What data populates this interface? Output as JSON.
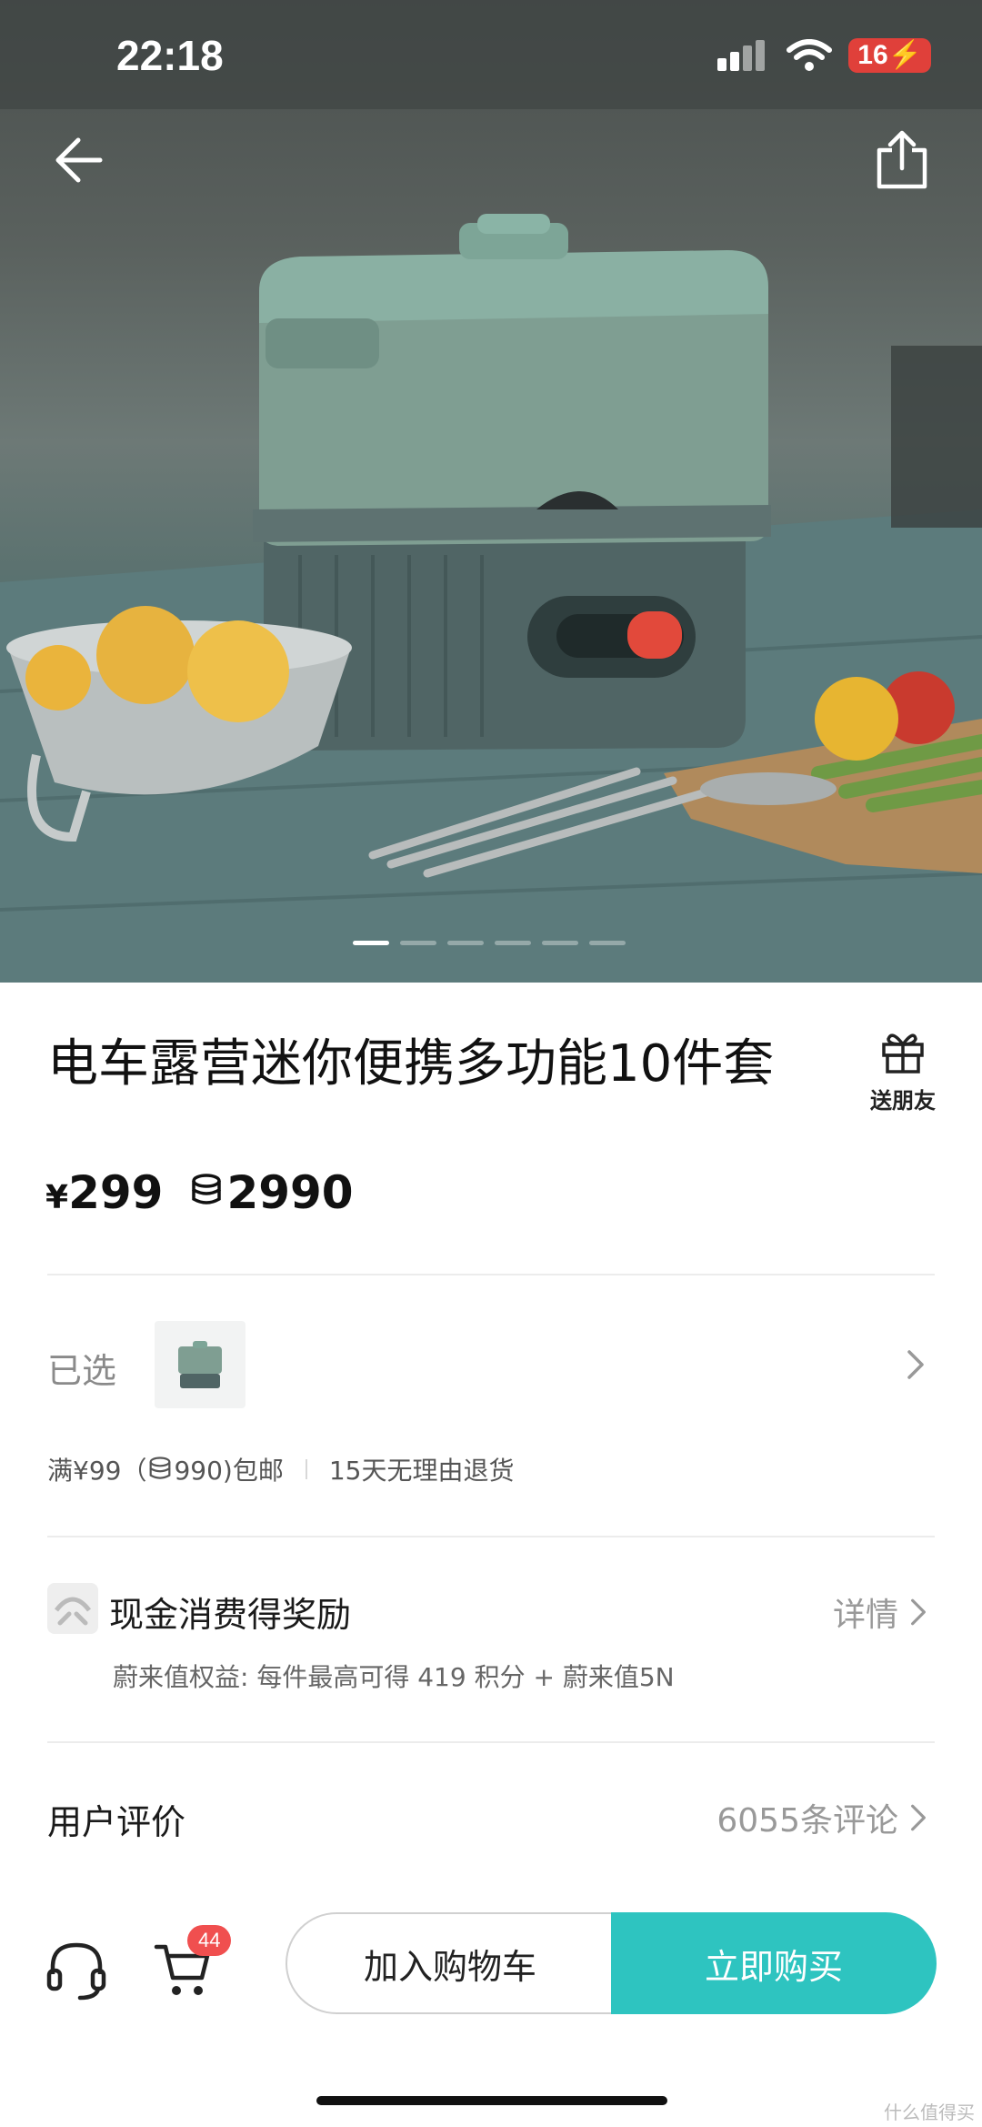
{
  "status_bar": {
    "time": "22:18",
    "battery": "16"
  },
  "product": {
    "title": "电车露营迷你便携多功能10件套",
    "price_symbol": "¥",
    "price": "299",
    "points": "2990",
    "gift_label": "送朋友"
  },
  "gallery": {
    "total": 6,
    "current": 1
  },
  "selection": {
    "label": "已选",
    "policy_shipping": "满¥99（",
    "policy_shipping_points": "990)包邮",
    "policy_return": "15天无理由退货"
  },
  "reward": {
    "title": "现金消费得奖励",
    "detail": "详情",
    "subtitle": "蔚来值权益:  每件最高可得 419 积分 + 蔚来值5N"
  },
  "reviews": {
    "title": "用户评价",
    "count": "6055条评论"
  },
  "bottom": {
    "cart_badge": "44",
    "add_to_cart": "加入购物车",
    "buy_now": "立即购买"
  },
  "watermark": "什么值得买",
  "colors": {
    "accent": "#2ec4c0",
    "badge": "#f04f4f",
    "battery": "#e0403a"
  }
}
